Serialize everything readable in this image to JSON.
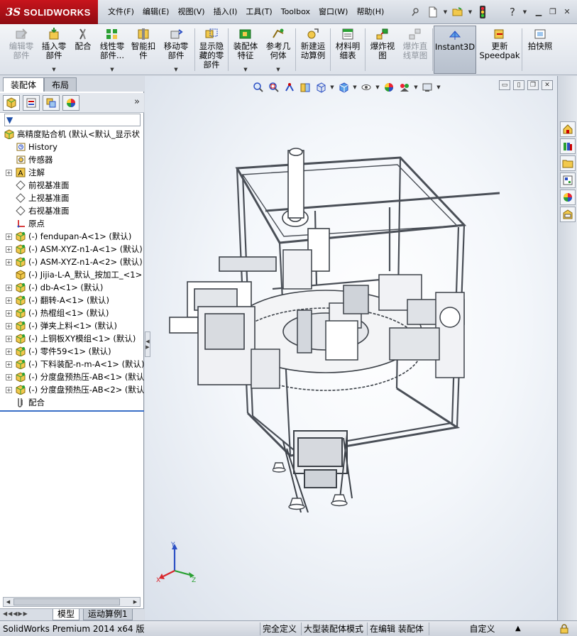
{
  "app": {
    "logo_ds": "3S",
    "logo_name": "SOLIDWORKS",
    "menu": [
      "文件(F)",
      "编辑(E)",
      "视图(V)",
      "插入(I)",
      "工具(T)",
      "Toolbox",
      "窗口(W)",
      "帮助(H)"
    ],
    "title_tool_icons": [
      "pin-icon",
      "new-document-icon",
      "open-folder-icon",
      "rebuild-traffic-light-icon",
      "help-icon"
    ],
    "window_controls": [
      "minimize",
      "restore",
      "close"
    ]
  },
  "command_manager": {
    "buttons": [
      {
        "label": "编辑零\n部件",
        "icon": "edit-component-icon",
        "enabled": false
      },
      {
        "label": "插入零\n部件",
        "icon": "insert-component-icon",
        "enabled": true,
        "dropdown": true
      },
      {
        "label": "配合",
        "icon": "mate-icon",
        "enabled": true
      },
      {
        "label": "线性零\n部件...",
        "icon": "linear-pattern-icon",
        "enabled": true,
        "dropdown": true
      },
      {
        "label": "智能扣\n件",
        "icon": "smart-fasteners-icon",
        "enabled": true
      },
      {
        "label": "移动零\n部件",
        "icon": "move-component-icon",
        "enabled": true,
        "dropdown": true
      },
      {
        "label": "显示隐\n藏的零\n部件",
        "icon": "show-hidden-components-icon",
        "enabled": true
      },
      {
        "label": "装配体\n特征",
        "icon": "assembly-features-icon",
        "enabled": true,
        "dropdown": true
      },
      {
        "label": "参考几\n何体",
        "icon": "reference-geometry-icon",
        "enabled": true,
        "dropdown": true
      },
      {
        "label": "新建运\n动算例",
        "icon": "new-motion-study-icon",
        "enabled": true
      },
      {
        "label": "材料明\n细表",
        "icon": "bill-of-materials-icon",
        "enabled": true
      },
      {
        "label": "爆炸视\n图",
        "icon": "exploded-view-icon",
        "enabled": true
      },
      {
        "label": "爆炸直\n线草图",
        "icon": "explode-line-sketch-icon",
        "enabled": false
      },
      {
        "label": "Instant3D",
        "icon": "instant3d-icon",
        "enabled": true,
        "active": true
      },
      {
        "label": "更新\nSpeedpak",
        "icon": "update-speedpak-icon",
        "enabled": true
      },
      {
        "label": "拍快照",
        "icon": "take-snapshot-icon",
        "enabled": true
      }
    ]
  },
  "left_panel": {
    "tabs": [
      "装配体",
      "布局"
    ],
    "active_tab": "装配体",
    "manager_tab_icons": [
      "featuremanager-icon",
      "propertymanager-icon",
      "configurationmanager-icon",
      "displaymanager-icon"
    ],
    "expand_label": "»",
    "tree": [
      {
        "label": "高精度贴合机  (默认<默认_显示状",
        "icon": "assembly-icon",
        "level": 0,
        "expander": false
      },
      {
        "label": "History",
        "icon": "history-icon",
        "level": 1,
        "expander": false
      },
      {
        "label": "传感器",
        "icon": "sensor-icon",
        "level": 1,
        "expander": false
      },
      {
        "label": "注解",
        "icon": "annotation-icon",
        "level": 1,
        "expander": true
      },
      {
        "label": "前视基准面",
        "icon": "plane-icon",
        "level": 1,
        "expander": false
      },
      {
        "label": "上视基准面",
        "icon": "plane-icon",
        "level": 1,
        "expander": false
      },
      {
        "label": "右视基准面",
        "icon": "plane-icon",
        "level": 1,
        "expander": false
      },
      {
        "label": "原点",
        "icon": "origin-icon",
        "level": 1,
        "expander": false
      },
      {
        "label": "(-) fendupan-A<1> (默认)",
        "icon": "subassembly-icon",
        "level": 1,
        "expander": true
      },
      {
        "label": "(-) ASM-XYZ-n1-A<1> (默认)",
        "icon": "subassembly-icon",
        "level": 1,
        "expander": true
      },
      {
        "label": "(-) ASM-XYZ-n1-A<2> (默认)",
        "icon": "subassembly-icon",
        "level": 1,
        "expander": true
      },
      {
        "label": "(-) Jijia-L-A_默认_按加工_<1>",
        "icon": "part-icon",
        "level": 1,
        "expander": false
      },
      {
        "label": "(-) db-A<1> (默认)",
        "icon": "subassembly-icon",
        "level": 1,
        "expander": true
      },
      {
        "label": "(-) 翻转-A<1> (默认)",
        "icon": "subassembly-icon",
        "level": 1,
        "expander": true
      },
      {
        "label": "(-) 热棍组<1> (默认)",
        "icon": "subassembly-icon",
        "level": 1,
        "expander": true
      },
      {
        "label": "(-) 弹夹上料<1> (默认)",
        "icon": "subassembly-icon",
        "level": 1,
        "expander": true
      },
      {
        "label": "(-) 上铜板XY模组<1> (默认)",
        "icon": "subassembly-icon",
        "level": 1,
        "expander": true
      },
      {
        "label": "(-) 零件59<1> (默认)",
        "icon": "subassembly-icon",
        "level": 1,
        "expander": true
      },
      {
        "label": "(-) 下料装配-n-m-A<1> (默认)",
        "icon": "subassembly-icon",
        "level": 1,
        "expander": true
      },
      {
        "label": "(-) 分度盘预热压-AB<1> (默认",
        "icon": "subassembly-icon",
        "level": 1,
        "expander": true
      },
      {
        "label": "(-) 分度盘预热压-AB<2> (默认",
        "icon": "subassembly-icon",
        "level": 1,
        "expander": true
      },
      {
        "label": "配合",
        "icon": "mates-folder-icon",
        "level": 1,
        "expander": false
      }
    ]
  },
  "viewport": {
    "hud_icons": [
      "zoom-to-fit-icon",
      "zoom-to-area-icon",
      "previous-view-icon",
      "section-view-icon",
      "view-orientation-icon",
      "display-style-icon",
      "hide-show-items-icon",
      "edit-appearance-icon",
      "apply-scene-icon",
      "view-settings-icon"
    ],
    "triad_axes": {
      "x": "X",
      "y": "Y",
      "z": "Z"
    },
    "colors": {
      "triad_x": "#d9262c",
      "triad_y": "#2aa033",
      "triad_z": "#2b4fc4",
      "frame": "#4a4f57"
    }
  },
  "task_pane": {
    "icons": [
      "solidworks-resources-icon",
      "design-library-icon",
      "file-explorer-icon",
      "view-palette-icon",
      "appearances-scenes-icon",
      "custom-properties-icon"
    ]
  },
  "bottom_tabs": {
    "tabs": [
      "模型",
      "运动算例1"
    ],
    "active": "模型"
  },
  "status_bar": {
    "app_name": "SolidWorks Premium 2014 x64 版",
    "fully_defined": "完全定义",
    "large_assembly": "大型装配体模式",
    "editing": "在编辑 装配体",
    "custom": "自定义"
  }
}
